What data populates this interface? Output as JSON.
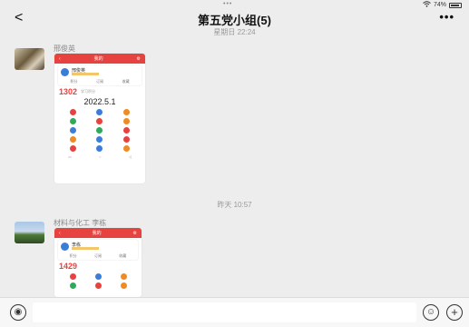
{
  "status": {
    "dots": "•••",
    "wifi_icon": "wifi-icon",
    "battery": "74%"
  },
  "header": {
    "back": "<",
    "title": "第五党小组(5)",
    "more": "•••"
  },
  "messages": [
    {
      "time": "星期日 22:24",
      "sender": "邢俊英",
      "shot": {
        "header_title": "我的",
        "name": "邢俊英",
        "stats": [
          "积分",
          "订阅",
          "收藏"
        ],
        "score": "1302",
        "score_note": "学习积分",
        "date": "2022.5.1"
      }
    },
    {
      "time": "昨天 10:57",
      "sender": "材料与化工 李栋",
      "shot": {
        "header_title": "我的",
        "name": "李栋",
        "stats": [
          "积分",
          "订阅",
          "收藏"
        ],
        "score": "1429",
        "score_note": "",
        "date": ""
      }
    }
  ],
  "icons": {
    "colors": [
      "#e64340",
      "#3b7dd8",
      "#f08a24",
      "#2eaa5c",
      "#e64340",
      "#f08a24",
      "#3b7dd8",
      "#2eaa5c",
      "#e64340",
      "#f08a24",
      "#3b7dd8",
      "#e64340",
      "#e64340",
      "#3b7dd8",
      "#f08a24"
    ]
  },
  "inputbar": {
    "voice_icon": "voice-icon",
    "emoji_icon": "emoji-icon",
    "plus_icon": "plus-icon",
    "voice_glyph": "◉",
    "emoji_glyph": "☺",
    "plus_glyph": "+"
  }
}
